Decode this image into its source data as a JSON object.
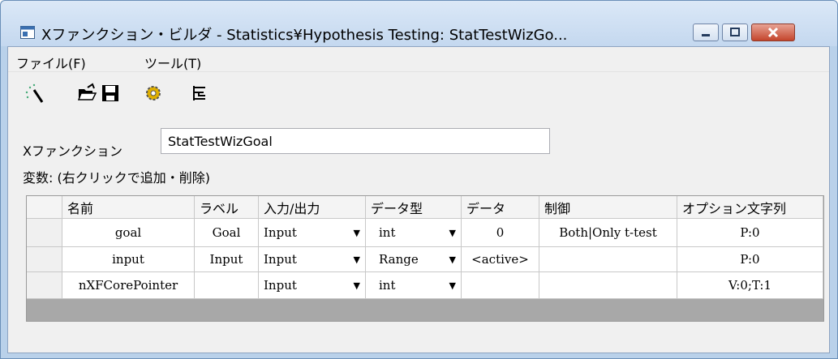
{
  "window": {
    "title": "Xファンクション・ビルダ - Statistics¥Hypothesis Testing: StatTestWizGo...",
    "icon": "app-window-icon",
    "controls": [
      "minimize-icon",
      "maximize-icon",
      "close-icon"
    ]
  },
  "menu": {
    "items": [
      {
        "label": "ファイル(F)"
      },
      {
        "label": "ツール(T)"
      }
    ]
  },
  "toolbar": {
    "buttons": [
      {
        "icon": "wand-new-icon"
      },
      {
        "icon": "open-folder-icon"
      },
      {
        "icon": "save-disk-icon"
      },
      {
        "icon": "compile-gear-icon"
      },
      {
        "icon": "tree-view-icon"
      }
    ]
  },
  "xfunction": {
    "label": "Xファンクション",
    "value": "StatTestWizGoal"
  },
  "variables": {
    "label": "変数: (右クリックで追加・削除)"
  },
  "table": {
    "columns": [
      "",
      "名前",
      "ラベル",
      "入力/出力",
      "データ型",
      "データ",
      "制御",
      "オプション文字列"
    ],
    "rows": [
      {
        "name": "goal",
        "label": "Goal",
        "io": "Input",
        "type": "int",
        "data": "0",
        "control": "Both|Only t-test",
        "option": "P:0"
      },
      {
        "name": "input",
        "label": "Input",
        "io": "Input",
        "type": "Range",
        "data": "<active>",
        "control": "",
        "option": "P:0"
      },
      {
        "name": "nXFCorePointer",
        "label": "",
        "io": "Input",
        "type": "int",
        "data": "",
        "control": "",
        "option": "V:0;T:1"
      }
    ]
  },
  "colors": {
    "title_bg": "#c4d8ef",
    "close_button": "#c4452c",
    "grid_empty": "#a8a8a8"
  }
}
